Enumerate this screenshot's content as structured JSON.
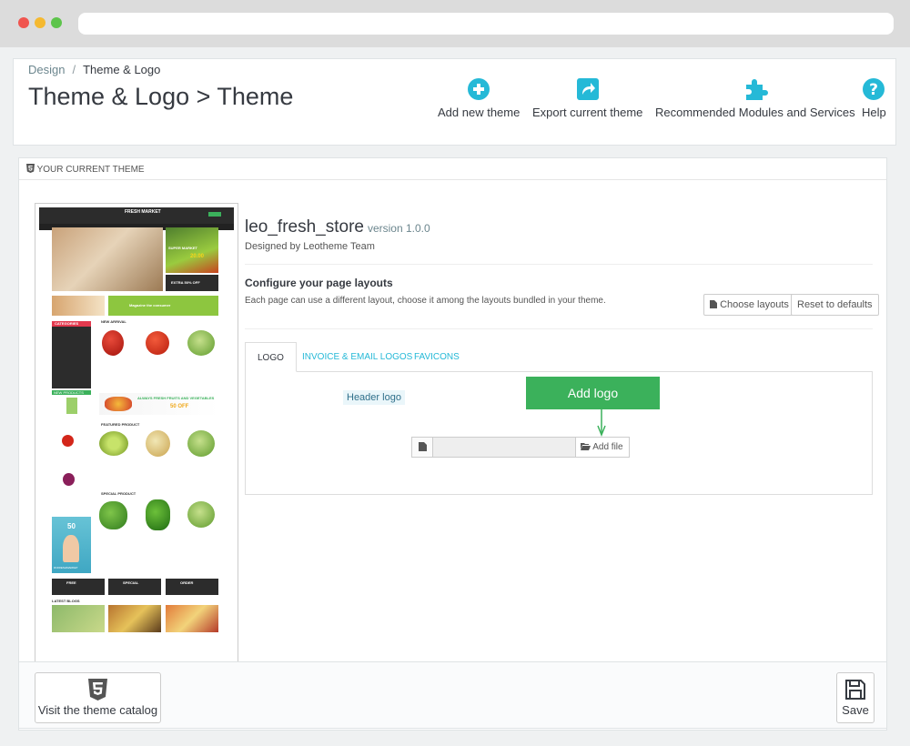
{
  "breadcrumb": {
    "parent": "Design",
    "separator": "/",
    "current": "Theme & Logo"
  },
  "page_title": "Theme & Logo > Theme",
  "toolbar": {
    "add_theme": "Add new theme",
    "export_theme": "Export current theme",
    "recommended": "Recommended Modules and Services",
    "help": "Help"
  },
  "panel": {
    "heading": "YOUR CURRENT THEME"
  },
  "theme": {
    "name": "leo_fresh_store",
    "version": "version 1.0.0",
    "designed_by": "Designed by Leotheme Team"
  },
  "layouts": {
    "title": "Configure your page layouts",
    "description": "Each page can use a different layout, choose it among the layouts bundled in your theme.",
    "choose_label": "Choose layouts",
    "reset_label": "Reset to defaults"
  },
  "tabs": [
    "LOGO",
    "INVOICE & EMAIL LOGOS",
    "FAVICONS"
  ],
  "logo_tab": {
    "header_logo_label": "Header logo",
    "callout": "Add logo",
    "add_file_label": "Add file"
  },
  "thumbnail": {
    "logo": "FRESH MARKET",
    "banner_super_market": "SUPER MARKET",
    "banner_price": "20.00",
    "banner_off": "EXTRA 50% OFF",
    "magazine": "Magazine the consumer",
    "categories": "CATEGORIES",
    "new_arrival": "NEW ARRIVAL",
    "new_products": "NEW PRODUCTS",
    "fresh_fruits": "ALWAYS FRESH FRUITS AND VEGETABLES",
    "fresh_off": "50 OFF",
    "featured": "FEATURED PRODUCT",
    "special": "SPECIAL PRODUCT",
    "promo_off": "50",
    "promo_tag": "#CFRESHMARKET",
    "free_label": "FREE",
    "special_label": "SPECIAL",
    "order_label": "ORDER",
    "latest_blogs": "LATEST BLOGS"
  },
  "footer": {
    "catalog_label": "Visit the theme catalog",
    "save_label": "Save"
  },
  "colors": {
    "accent": "#25b9d7",
    "green_callout": "#3bb15b",
    "text": "#363a41"
  },
  "icons": [
    "plus-circle-icon",
    "share-icon",
    "puzzle-icon",
    "help-icon",
    "html5-icon",
    "file-icon",
    "folder-open-icon",
    "save-icon"
  ]
}
